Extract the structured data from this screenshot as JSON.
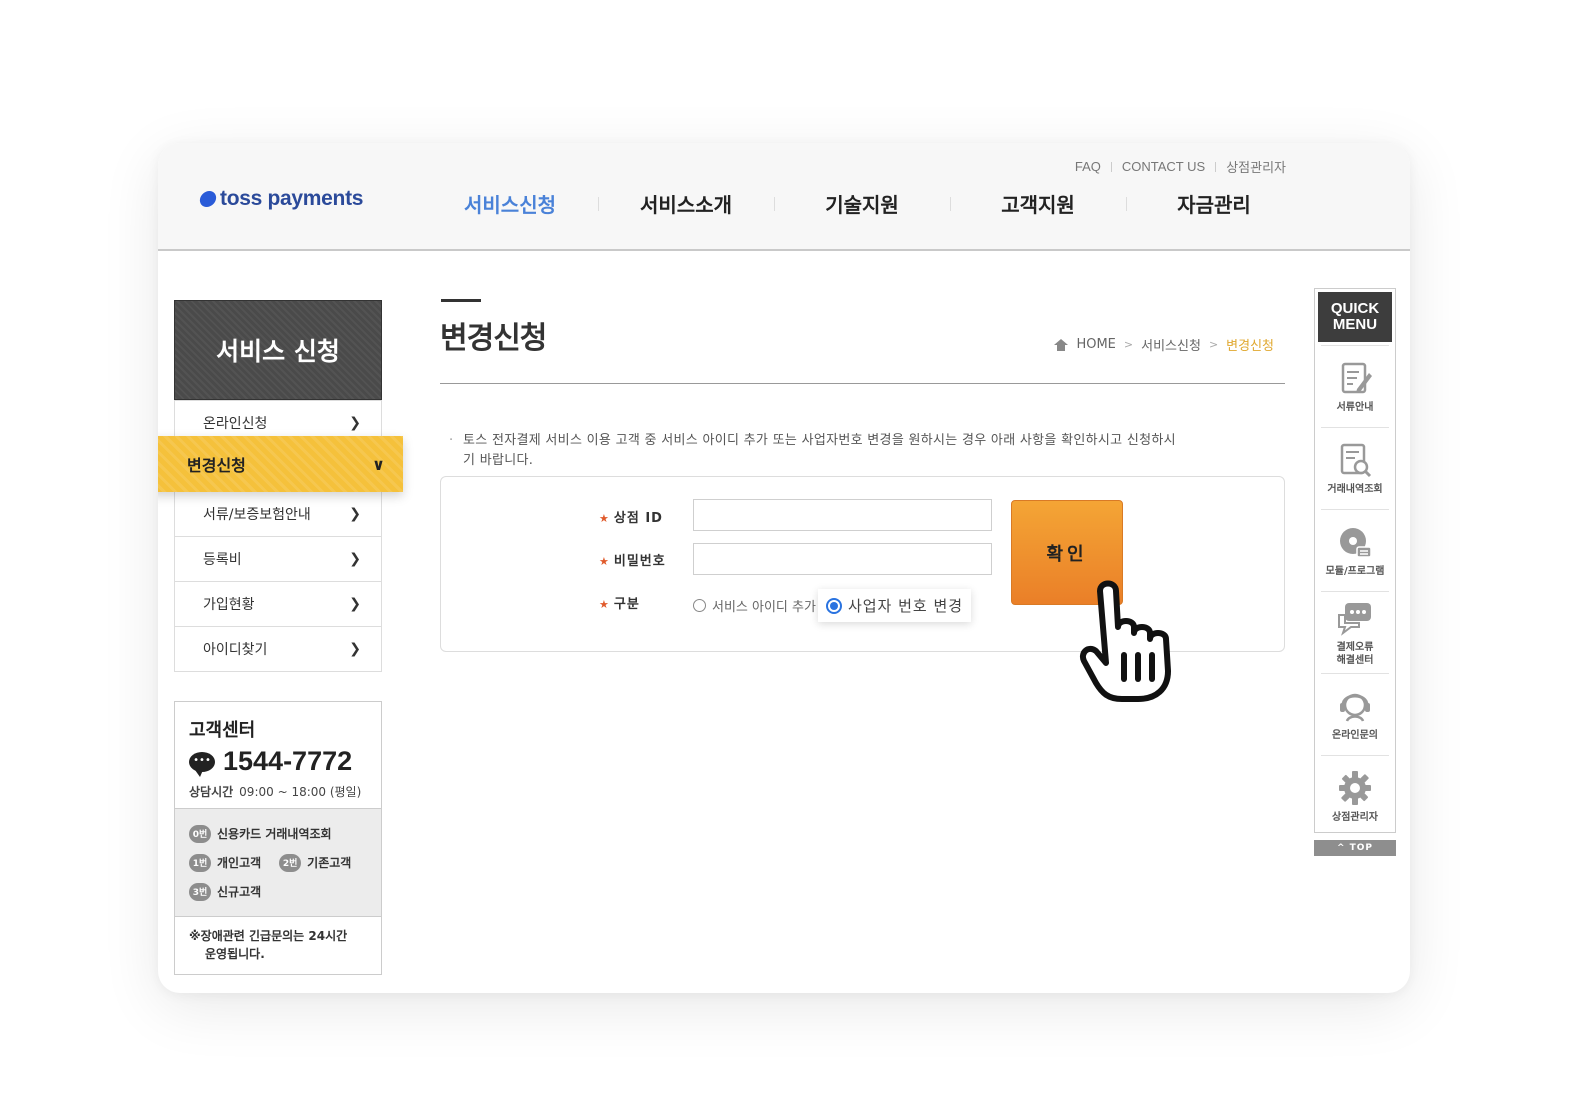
{
  "header": {
    "logo_text": "toss payments",
    "util_links": [
      "FAQ",
      "CONTACT US",
      "상점관리자"
    ],
    "gnb": [
      {
        "label": "서비스신청",
        "active": true
      },
      {
        "label": "서비스소개",
        "active": false
      },
      {
        "label": "기술지원",
        "active": false
      },
      {
        "label": "고객지원",
        "active": false
      },
      {
        "label": "자금관리",
        "active": false
      }
    ]
  },
  "sidebar": {
    "title": "서비스 신청",
    "items": [
      {
        "label": "온라인신청"
      },
      {
        "label": "변경신청",
        "active": true
      },
      {
        "label": "서류/보증보험안내"
      },
      {
        "label": "등록비"
      },
      {
        "label": "가입현황"
      },
      {
        "label": "아이디찾기"
      }
    ],
    "customer_center": {
      "title": "고객센터",
      "phone": "1544-7772",
      "hours_label": "상담시간",
      "hours": "09:00 ~ 18:00 (평일)",
      "options": [
        {
          "num": "0번",
          "label": "신용카드 거래내역조회"
        },
        {
          "num": "1번",
          "label": "개인고객"
        },
        {
          "num": "2번",
          "label": "기존고객"
        },
        {
          "num": "3번",
          "label": "신규고객"
        }
      ],
      "note_line1": "※장애관련 긴급문의는 24시간",
      "note_line2": "운영됩니다."
    }
  },
  "main": {
    "page_title": "변경신청",
    "breadcrumb": [
      "HOME",
      "서비스신청",
      "변경신청"
    ],
    "notice_line1": "토스 전자결제 서비스 이용 고객 중 서비스 아이디 추가 또는 사업자번호 변경을 원하시는 경우 아래 사항을 확인하시고 신청하시",
    "notice_line2": "기 바랍니다.",
    "form": {
      "store_id_label": "상점 ID",
      "password_label": "비밀번호",
      "type_label": "구분",
      "store_id_value": "",
      "password_value": "",
      "radio_options": [
        {
          "label": "서비스 아이디 추가",
          "checked": false
        },
        {
          "label": "사업자 번호 변경",
          "checked": true
        }
      ],
      "confirm_label": "확인"
    }
  },
  "quick_menu": {
    "title_line1": "QUICK",
    "title_line2": "MENU",
    "items": [
      {
        "label": "서류안내",
        "icon": "document-edit-icon"
      },
      {
        "label": "거래내역조회",
        "icon": "document-search-icon"
      },
      {
        "label": "모듈/프로그램",
        "icon": "disc-module-icon"
      },
      {
        "label_line1": "결제오류",
        "label_line2": "해결센터",
        "icon": "chat-bubble-icon"
      },
      {
        "label": "온라인문의",
        "icon": "headset-agent-icon"
      },
      {
        "label": "상점관리자",
        "icon": "gear-icon"
      }
    ],
    "top_label": "^ TOP"
  },
  "colors": {
    "gnb_active": "#4a82d8",
    "sidebar_active": "#f5c13b",
    "confirm_button": "#ea7f28",
    "breadcrumb_current": "#e0a830",
    "radio_checked": "#2a73e0"
  }
}
